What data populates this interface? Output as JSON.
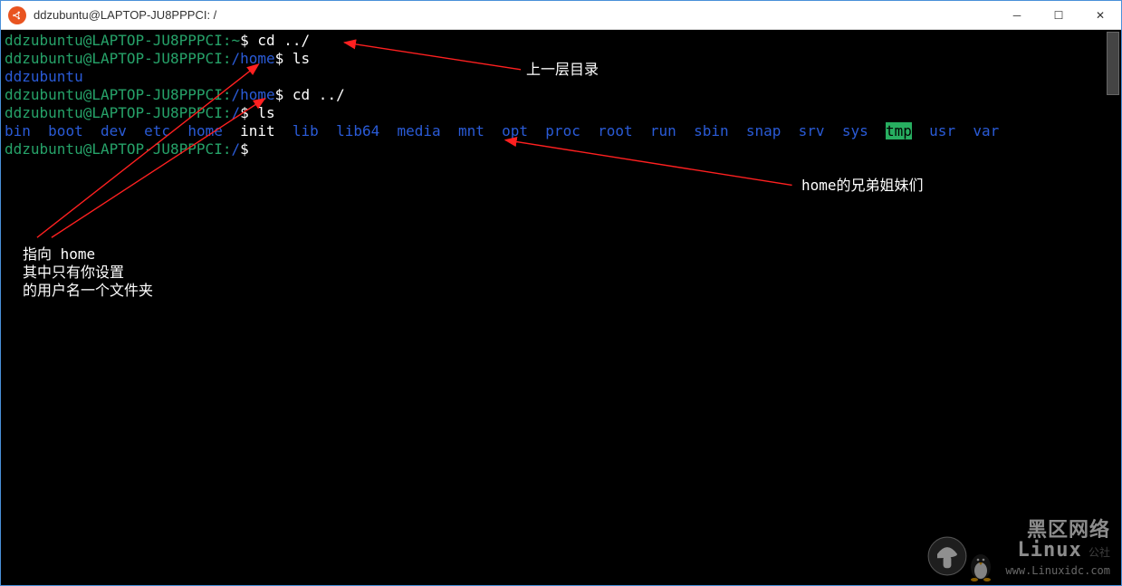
{
  "window": {
    "title": "ddzubuntu@LAPTOP-JU8PPPCI: /"
  },
  "prompt": {
    "userhost": "ddzubuntu@LAPTOP-JU8PPPCI",
    "sep": ":"
  },
  "lines": {
    "l1_path": "~",
    "l1_cmd": "cd ../",
    "l2_path": "/home",
    "l2_cmd": "ls",
    "l3_output": "ddzubuntu",
    "l4_path": "/home",
    "l4_cmd": "cd ../",
    "l5_path": "/",
    "l5_cmd": "ls",
    "l7_path": "/"
  },
  "ls_root": {
    "dirs": [
      "bin",
      "boot",
      "dev",
      "etc",
      "home"
    ],
    "file": "init",
    "dirs2": [
      "lib",
      "lib64",
      "media",
      "mnt",
      "opt",
      "proc",
      "root",
      "run",
      "sbin",
      "snap",
      "srv",
      "sys"
    ],
    "sticky": "tmp",
    "dirs3": [
      "usr",
      "var"
    ]
  },
  "annotations": {
    "top": "上一层目录",
    "right": "home的兄弟姐妹们",
    "left_l1": "指向 home",
    "left_l2": "其中只有你设置",
    "left_l3": "的用户名一个文件夹"
  },
  "watermark": {
    "brand1": "黑区网络",
    "brand2": "Linux",
    "url": "www.Linuxidc.com"
  },
  "buttons": {
    "min": "─",
    "max": "☐",
    "close": "✕"
  }
}
